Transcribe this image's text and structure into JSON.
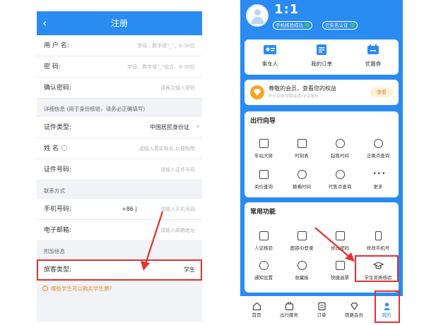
{
  "left": {
    "header": {
      "title": "注册",
      "back_icon": "chevron-left-icon"
    },
    "fields": [
      {
        "label": "用 户 名:",
        "placeholder": "字母、数字或\"_\"、6-30位"
      },
      {
        "label": "密    码:",
        "placeholder": "字母、数字或\"_\"组合、6-30位"
      },
      {
        "label": "确认密码:",
        "placeholder": "请再次输入密码"
      }
    ],
    "detail_section": "详细信息 (用于身份核验，请务必正确填写)",
    "id_fields": [
      {
        "label": "证件类型:",
        "value": "中国居民身份证"
      },
      {
        "label": "姓    名",
        "placeholder": "请输入真实姓名,以便购票"
      },
      {
        "label": "证件号码:",
        "placeholder": "请输入证件号码"
      }
    ],
    "contact_section": "联系方式",
    "contact_fields": [
      {
        "label": "手机号码:",
        "code": "+86",
        "placeholder": "请输入手机号码"
      },
      {
        "label": "电子邮箱:",
        "placeholder": "请输入邮箱地址"
      }
    ],
    "extra_section": "附加信息",
    "passenger_type": {
      "label": "旅客类型:",
      "value": "学生"
    },
    "notice": "哪些学生可以购买学生票?"
  },
  "right": {
    "user": {
      "name": "1:1",
      "badge1": "手机核验成功",
      "badge2": "已实名认证"
    },
    "quick": [
      {
        "label": "乘车人",
        "icon": "passenger-card-icon"
      },
      {
        "label": "我的订单",
        "icon": "order-list-icon"
      },
      {
        "label": "优惠券",
        "icon": "coupon-icon"
      }
    ],
    "vip": {
      "title": "尊敬的会员，查看您的权益",
      "subtitle": "积分兑换(铁路会员)专享服务",
      "button": "查看"
    },
    "guide": {
      "title": "出行向导",
      "items": [
        {
          "label": "车站大屏",
          "icon": "station-screen-icon"
        },
        {
          "label": "时刻表",
          "icon": "timetable-icon"
        },
        {
          "label": "起售时间",
          "icon": "sale-time-icon"
        },
        {
          "label": "正晚点查询",
          "icon": "delay-query-icon"
        },
        {
          "label": "卖价查询",
          "icon": "price-query-icon"
        },
        {
          "label": "换乘时间",
          "icon": "transfer-time-icon"
        },
        {
          "label": "代售点查询",
          "icon": "agency-query-icon"
        },
        {
          "label": "更多",
          "icon": "more-icon"
        }
      ]
    },
    "common": {
      "title": "常用功能",
      "items": [
        {
          "label": "人证核验",
          "icon": "id-verify-icon"
        },
        {
          "label": "面容ID登录",
          "icon": "face-id-icon"
        },
        {
          "label": "修改密码",
          "icon": "lock-icon"
        },
        {
          "label": "修改手机号",
          "icon": "phone-icon"
        },
        {
          "label": "通知设置",
          "icon": "bell-icon"
        },
        {
          "label": "收藏板",
          "icon": "heart-icon"
        },
        {
          "label": "快捷退票",
          "icon": "refund-icon"
        },
        {
          "label": "学生资质核验",
          "icon": "graduation-cap-icon"
        }
      ]
    },
    "tabs": [
      {
        "label": "首页",
        "icon": "home-icon"
      },
      {
        "label": "出行服务",
        "icon": "travel-service-icon"
      },
      {
        "label": "订单",
        "icon": "order-icon"
      },
      {
        "label": "铁路会员",
        "icon": "member-icon"
      },
      {
        "label": "我的",
        "icon": "user-icon"
      }
    ]
  },
  "colors": {
    "primary": "#2a8bf2",
    "highlight": "#e5302f",
    "accent": "#e08a2a"
  }
}
